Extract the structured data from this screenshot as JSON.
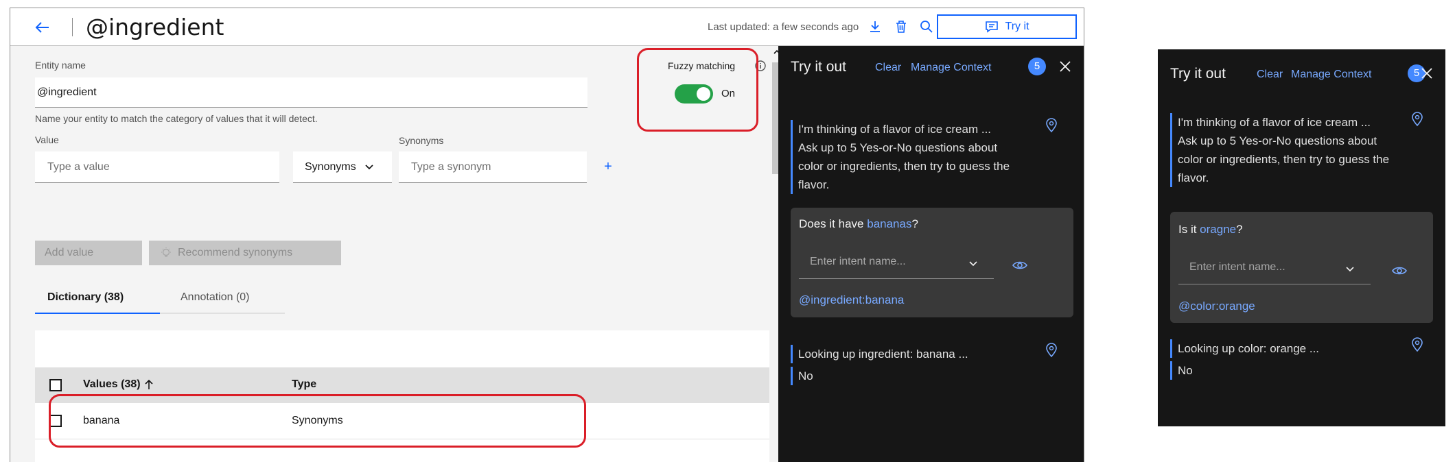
{
  "header": {
    "title": "@ingredient",
    "last_updated": "Last updated: a few seconds ago",
    "try_it_label": "Try it"
  },
  "editor": {
    "entity_name_label": "Entity name",
    "entity_name_value": "@ingredient",
    "entity_name_helper": "Name your entity to match the category of values that it will detect.",
    "value_label": "Value",
    "value_placeholder": "Type a value",
    "type_select_value": "Synonyms",
    "synonyms_label": "Synonyms",
    "synonym_placeholder": "Type a synonym",
    "add_synonym_symbol": "+",
    "fuzzy_matching_label": "Fuzzy matching",
    "fuzzy_matching_state": "On",
    "add_value_label": "Add value",
    "recommend_label": "Recommend synonyms",
    "tabs": [
      {
        "label": "Dictionary (38)",
        "active": true
      },
      {
        "label": "Annotation (0)",
        "active": false
      }
    ],
    "table": {
      "columns": [
        "Values (38)",
        "Type"
      ],
      "rows": [
        {
          "value": "banana",
          "type": "Synonyms"
        }
      ]
    }
  },
  "try_panels": [
    {
      "title": "Try it out",
      "clear_label": "Clear",
      "manage_context_label": "Manage Context",
      "context_count": "5",
      "bot_messages": [
        "I'm thinking of a flavor of ice cream ...",
        "Ask up to 5 Yes-or-No questions about color or ingredients, then try to guess the flavor."
      ],
      "user_message_prefix": "Does it have ",
      "user_message_highlight": "bananas",
      "user_message_suffix": "?",
      "intent_placeholder": "Enter intent name...",
      "entity_detected": "@ingredient:banana",
      "lookup_message": "Looking up ingredient: banana ...",
      "answer": "No"
    },
    {
      "title": "Try it out",
      "clear_label": "Clear",
      "manage_context_label": "Manage Context",
      "context_count": "5",
      "bot_messages": [
        "I'm thinking of a flavor of ice cream ...",
        "Ask up to 5 Yes-or-No questions about color or ingredients, then try to guess the flavor."
      ],
      "user_message_prefix": "Is it ",
      "user_message_highlight": "oragne",
      "user_message_suffix": "?",
      "intent_placeholder": "Enter intent name...",
      "entity_detected": "@color:orange",
      "lookup_message": "Looking up color: orange ...",
      "answer": "No"
    }
  ],
  "colors": {
    "accent": "#0f62fe",
    "toggle_on": "#24a148",
    "highlight": "#da1e28",
    "panel_bg": "#161616"
  }
}
